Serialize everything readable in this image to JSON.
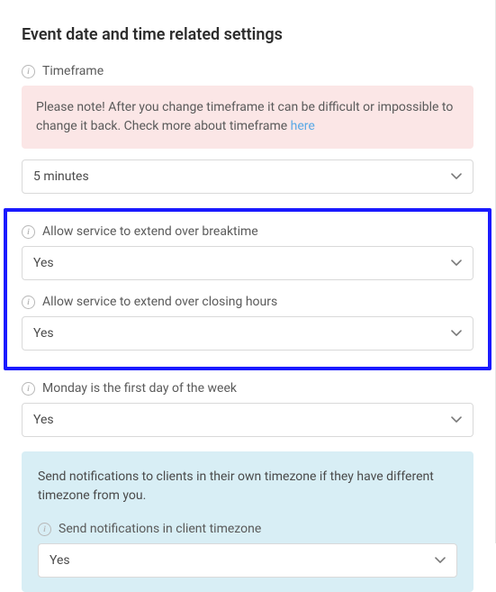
{
  "heading": "Event date and time related settings",
  "timeframe": {
    "label": "Timeframe",
    "alert_text": "Please note! After you change timeframe it can be difficult or impossible to change it back. Check more about timeframe ",
    "alert_link": "here",
    "value": "5 minutes"
  },
  "breaktime": {
    "label": "Allow service to extend over breaktime",
    "value": "Yes"
  },
  "closing": {
    "label": "Allow service to extend over closing hours",
    "value": "Yes"
  },
  "monday": {
    "label": "Monday is the first day of the week",
    "value": "Yes"
  },
  "tz_panel": {
    "intro": "Send notifications to clients in their own timezone if they have different timezone from you.",
    "label": "Send notifications in client timezone",
    "value": "Yes"
  }
}
